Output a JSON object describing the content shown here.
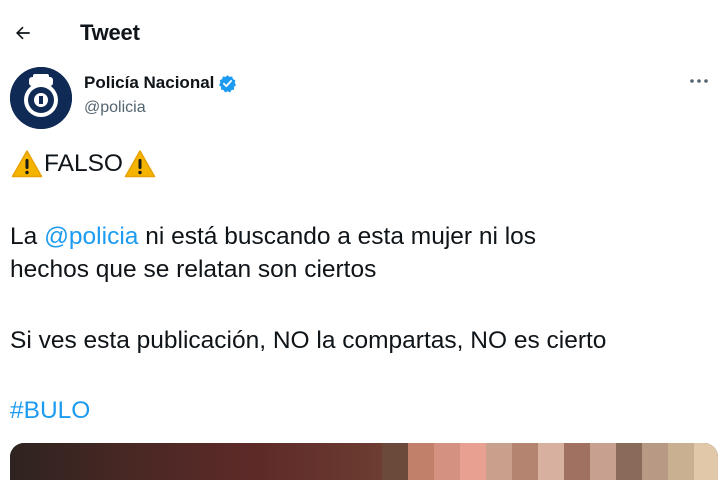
{
  "header": {
    "title": "Tweet",
    "back_icon": "arrow-left-icon"
  },
  "author": {
    "name": "Policía Nacional",
    "handle": "@policia",
    "avatar_icon": "police-badge-icon",
    "verified_icon": "verified-badge-icon",
    "verified_color": "#1d9bf0"
  },
  "more_icon": "more-horizontal-icon",
  "tweet": {
    "line1": {
      "warning_icon": "warning-sign-icon",
      "text": "FALSO"
    },
    "line2": {
      "prefix": "La ",
      "mention": "@policia",
      "suffix": " ni está buscando a esta mujer ni los"
    },
    "line3": "hechos que se relatan son ciertos",
    "line4": "Si ves esta publicación, NO la compartas, NO es cierto",
    "hashtag": "#BULO"
  },
  "colors": {
    "link": "#1d9bf0",
    "text": "#0f1419",
    "secondary": "#536471",
    "warning": "#f4b400"
  }
}
